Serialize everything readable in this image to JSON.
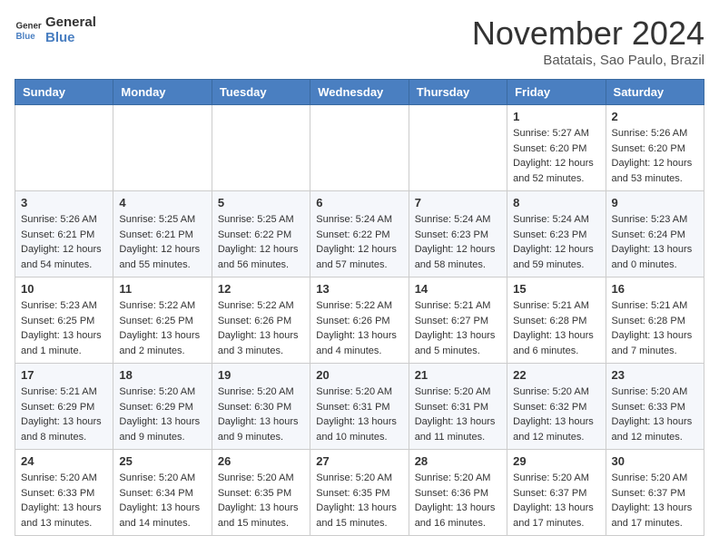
{
  "header": {
    "logo_line1": "General",
    "logo_line2": "Blue",
    "month": "November 2024",
    "location": "Batatais, Sao Paulo, Brazil"
  },
  "weekdays": [
    "Sunday",
    "Monday",
    "Tuesday",
    "Wednesday",
    "Thursday",
    "Friday",
    "Saturday"
  ],
  "weeks": [
    [
      {
        "day": "",
        "sunrise": "",
        "sunset": "",
        "daylight": ""
      },
      {
        "day": "",
        "sunrise": "",
        "sunset": "",
        "daylight": ""
      },
      {
        "day": "",
        "sunrise": "",
        "sunset": "",
        "daylight": ""
      },
      {
        "day": "",
        "sunrise": "",
        "sunset": "",
        "daylight": ""
      },
      {
        "day": "",
        "sunrise": "",
        "sunset": "",
        "daylight": ""
      },
      {
        "day": "1",
        "sunrise": "Sunrise: 5:27 AM",
        "sunset": "Sunset: 6:20 PM",
        "daylight": "Daylight: 12 hours and 52 minutes."
      },
      {
        "day": "2",
        "sunrise": "Sunrise: 5:26 AM",
        "sunset": "Sunset: 6:20 PM",
        "daylight": "Daylight: 12 hours and 53 minutes."
      }
    ],
    [
      {
        "day": "3",
        "sunrise": "Sunrise: 5:26 AM",
        "sunset": "Sunset: 6:21 PM",
        "daylight": "Daylight: 12 hours and 54 minutes."
      },
      {
        "day": "4",
        "sunrise": "Sunrise: 5:25 AM",
        "sunset": "Sunset: 6:21 PM",
        "daylight": "Daylight: 12 hours and 55 minutes."
      },
      {
        "day": "5",
        "sunrise": "Sunrise: 5:25 AM",
        "sunset": "Sunset: 6:22 PM",
        "daylight": "Daylight: 12 hours and 56 minutes."
      },
      {
        "day": "6",
        "sunrise": "Sunrise: 5:24 AM",
        "sunset": "Sunset: 6:22 PM",
        "daylight": "Daylight: 12 hours and 57 minutes."
      },
      {
        "day": "7",
        "sunrise": "Sunrise: 5:24 AM",
        "sunset": "Sunset: 6:23 PM",
        "daylight": "Daylight: 12 hours and 58 minutes."
      },
      {
        "day": "8",
        "sunrise": "Sunrise: 5:24 AM",
        "sunset": "Sunset: 6:23 PM",
        "daylight": "Daylight: 12 hours and 59 minutes."
      },
      {
        "day": "9",
        "sunrise": "Sunrise: 5:23 AM",
        "sunset": "Sunset: 6:24 PM",
        "daylight": "Daylight: 13 hours and 0 minutes."
      }
    ],
    [
      {
        "day": "10",
        "sunrise": "Sunrise: 5:23 AM",
        "sunset": "Sunset: 6:25 PM",
        "daylight": "Daylight: 13 hours and 1 minute."
      },
      {
        "day": "11",
        "sunrise": "Sunrise: 5:22 AM",
        "sunset": "Sunset: 6:25 PM",
        "daylight": "Daylight: 13 hours and 2 minutes."
      },
      {
        "day": "12",
        "sunrise": "Sunrise: 5:22 AM",
        "sunset": "Sunset: 6:26 PM",
        "daylight": "Daylight: 13 hours and 3 minutes."
      },
      {
        "day": "13",
        "sunrise": "Sunrise: 5:22 AM",
        "sunset": "Sunset: 6:26 PM",
        "daylight": "Daylight: 13 hours and 4 minutes."
      },
      {
        "day": "14",
        "sunrise": "Sunrise: 5:21 AM",
        "sunset": "Sunset: 6:27 PM",
        "daylight": "Daylight: 13 hours and 5 minutes."
      },
      {
        "day": "15",
        "sunrise": "Sunrise: 5:21 AM",
        "sunset": "Sunset: 6:28 PM",
        "daylight": "Daylight: 13 hours and 6 minutes."
      },
      {
        "day": "16",
        "sunrise": "Sunrise: 5:21 AM",
        "sunset": "Sunset: 6:28 PM",
        "daylight": "Daylight: 13 hours and 7 minutes."
      }
    ],
    [
      {
        "day": "17",
        "sunrise": "Sunrise: 5:21 AM",
        "sunset": "Sunset: 6:29 PM",
        "daylight": "Daylight: 13 hours and 8 minutes."
      },
      {
        "day": "18",
        "sunrise": "Sunrise: 5:20 AM",
        "sunset": "Sunset: 6:29 PM",
        "daylight": "Daylight: 13 hours and 9 minutes."
      },
      {
        "day": "19",
        "sunrise": "Sunrise: 5:20 AM",
        "sunset": "Sunset: 6:30 PM",
        "daylight": "Daylight: 13 hours and 9 minutes."
      },
      {
        "day": "20",
        "sunrise": "Sunrise: 5:20 AM",
        "sunset": "Sunset: 6:31 PM",
        "daylight": "Daylight: 13 hours and 10 minutes."
      },
      {
        "day": "21",
        "sunrise": "Sunrise: 5:20 AM",
        "sunset": "Sunset: 6:31 PM",
        "daylight": "Daylight: 13 hours and 11 minutes."
      },
      {
        "day": "22",
        "sunrise": "Sunrise: 5:20 AM",
        "sunset": "Sunset: 6:32 PM",
        "daylight": "Daylight: 13 hours and 12 minutes."
      },
      {
        "day": "23",
        "sunrise": "Sunrise: 5:20 AM",
        "sunset": "Sunset: 6:33 PM",
        "daylight": "Daylight: 13 hours and 12 minutes."
      }
    ],
    [
      {
        "day": "24",
        "sunrise": "Sunrise: 5:20 AM",
        "sunset": "Sunset: 6:33 PM",
        "daylight": "Daylight: 13 hours and 13 minutes."
      },
      {
        "day": "25",
        "sunrise": "Sunrise: 5:20 AM",
        "sunset": "Sunset: 6:34 PM",
        "daylight": "Daylight: 13 hours and 14 minutes."
      },
      {
        "day": "26",
        "sunrise": "Sunrise: 5:20 AM",
        "sunset": "Sunset: 6:35 PM",
        "daylight": "Daylight: 13 hours and 15 minutes."
      },
      {
        "day": "27",
        "sunrise": "Sunrise: 5:20 AM",
        "sunset": "Sunset: 6:35 PM",
        "daylight": "Daylight: 13 hours and 15 minutes."
      },
      {
        "day": "28",
        "sunrise": "Sunrise: 5:20 AM",
        "sunset": "Sunset: 6:36 PM",
        "daylight": "Daylight: 13 hours and 16 minutes."
      },
      {
        "day": "29",
        "sunrise": "Sunrise: 5:20 AM",
        "sunset": "Sunset: 6:37 PM",
        "daylight": "Daylight: 13 hours and 17 minutes."
      },
      {
        "day": "30",
        "sunrise": "Sunrise: 5:20 AM",
        "sunset": "Sunset: 6:37 PM",
        "daylight": "Daylight: 13 hours and 17 minutes."
      }
    ]
  ]
}
